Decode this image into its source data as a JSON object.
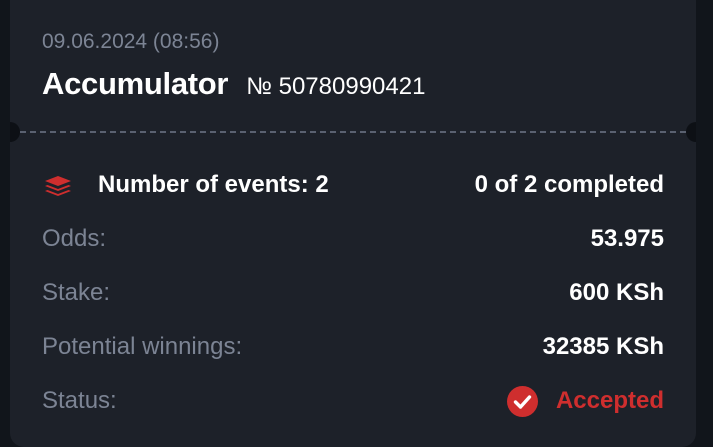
{
  "bet": {
    "date": "09.06.2024 (08:56)",
    "type": "Accumulator",
    "number": "№ 50780990421"
  },
  "events": {
    "label": "Number of events: 2",
    "progress": "0 of 2 completed",
    "icon": "layers-icon"
  },
  "details": [
    {
      "label": "Odds:",
      "value": "53.975"
    },
    {
      "label": "Stake:",
      "value": "600 KSh"
    },
    {
      "label": "Potential winnings:",
      "value": "32385 KSh"
    },
    {
      "label": "Status:",
      "value": "Accepted"
    }
  ],
  "colors": {
    "accent": "#cf2e2e",
    "card_bg": "#1d2129",
    "muted_text": "#7c8494"
  }
}
